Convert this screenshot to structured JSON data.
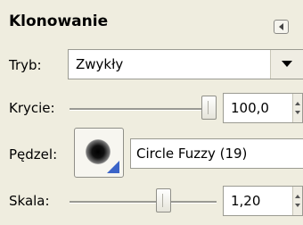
{
  "panel": {
    "title": "Klonowanie"
  },
  "mode": {
    "label": "Tryb:",
    "value": "Zwykły"
  },
  "opacity": {
    "label": "Krycie:",
    "value": "100,0",
    "level": 1.0
  },
  "brush": {
    "label": "Pędzel:",
    "name": "Circle Fuzzy (19)"
  },
  "scale": {
    "label": "Skala:",
    "value": "1,20",
    "level": 0.55
  }
}
